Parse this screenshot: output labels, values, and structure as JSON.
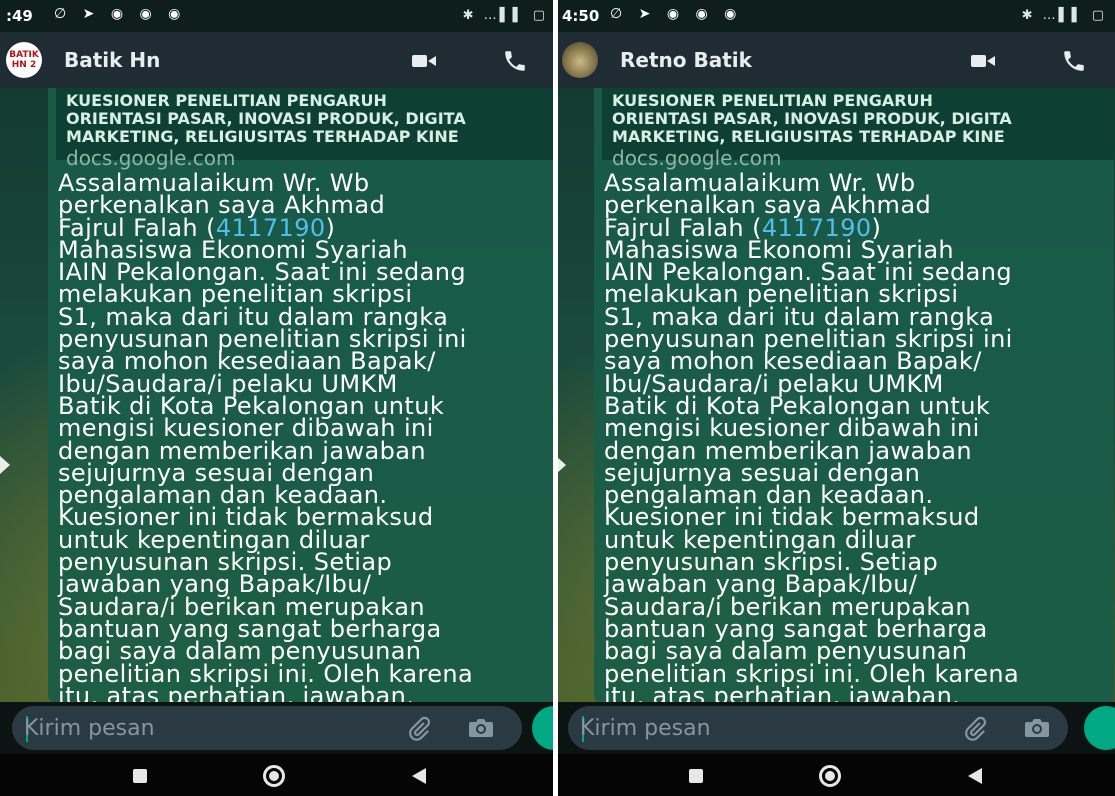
{
  "left": {
    "status": {
      "time": ":49",
      "icons": "∅ ➤ ◉ ◉ ◉",
      "right_icons": "✱ …▌▌ ▢"
    },
    "header": {
      "contact_name": "Batik Hn",
      "avatar_text": "BATIK HN 2"
    },
    "link_preview": {
      "title": "KUESIONER PENELITIAN PENGARUH\nORIENTASI PASAR, INOVASI PRODUK, DIGITA\nMARKETING, RELIGIUSITAS TERHADAP KINE",
      "domain": "docs.google.com"
    },
    "message": {
      "before_link": "Assalamualaikum Wr. Wb\nperkenalkan saya Akhmad\nFajrul Falah (",
      "link": "4117190",
      "after_link": ")\nMahasiswa Ekonomi Syariah\nIAIN Pekalongan. Saat ini sedang\nmelakukan penelitian skripsi\nS1, maka dari itu dalam rangka\npenyusunan penelitian skripsi ini\nsaya mohon kesediaan Bapak/\nIbu/Saudara/i pelaku UMKM\nBatik di Kota Pekalongan untuk\nmengisi kuesioner dibawah ini\ndengan memberikan jawaban\nsejujurnya sesuai dengan\npengalaman dan keadaan.\nKuesioner ini tidak bermaksud\nuntuk kepentingan diluar\npenyusunan skripsi. Setiap\njawaban yang Bapak/Ibu/\nSaudara/i berikan merupakan\nbantuan yang sangat berharga\nbagi saya dalam penyusunan\npenelitian skripsi ini. Oleh karena\nitu, atas perhatian, jawaban,\nkerja sama Bapak/Ibu/Saudara/"
    },
    "composer": {
      "placeholder": "Kirim pesan"
    }
  },
  "right": {
    "status": {
      "time": "4:50",
      "icons": "∅ ➤ ◉ ◉ ◉",
      "right_icons": "✱ …▌▌ ▢"
    },
    "header": {
      "contact_name": "Retno Batik"
    },
    "link_preview": {
      "title": "KUESIONER PENELITIAN PENGARUH\nORIENTASI PASAR, INOVASI PRODUK, DIGITA\nMARKETING, RELIGIUSITAS TERHADAP KINE",
      "domain": "docs.google.com"
    },
    "message": {
      "before_link": "Assalamualaikum Wr. Wb\nperkenalkan saya Akhmad\nFajrul Falah (",
      "link": "4117190",
      "after_link": ")\nMahasiswa Ekonomi Syariah\nIAIN Pekalongan. Saat ini sedang\nmelakukan penelitian skripsi\nS1, maka dari itu dalam rangka\npenyusunan penelitian skripsi ini\nsaya mohon kesediaan Bapak/\nIbu/Saudara/i pelaku UMKM\nBatik di Kota Pekalongan untuk\nmengisi kuesioner dibawah ini\ndengan memberikan jawaban\nsejujurnya sesuai dengan\npengalaman dan keadaan.\nKuesioner ini tidak bermaksud\nuntuk kepentingan diluar\npenyusunan skripsi. Setiap\njawaban yang Bapak/Ibu/\nSaudara/i berikan merupakan\nbantuan yang sangat berharga\nbagi saya dalam penyusunan\npenelitian skripsi ini. Oleh karena\nitu, atas perhatian, jawaban,\nkerja sama Bapak/Ibu/Saudara/"
    },
    "composer": {
      "placeholder": "Kirim pesan"
    }
  },
  "colors": {
    "bubble": "#195c48",
    "header": "#1f2c33",
    "link": "#53bdeb",
    "accent": "#00a884"
  },
  "icons": {
    "header": [
      "video-call-icon",
      "phone-call-icon"
    ],
    "composer": [
      "attach-icon",
      "camera-icon",
      "mic-icon"
    ],
    "nav": [
      "recent-apps-icon",
      "home-icon",
      "back-icon"
    ]
  }
}
